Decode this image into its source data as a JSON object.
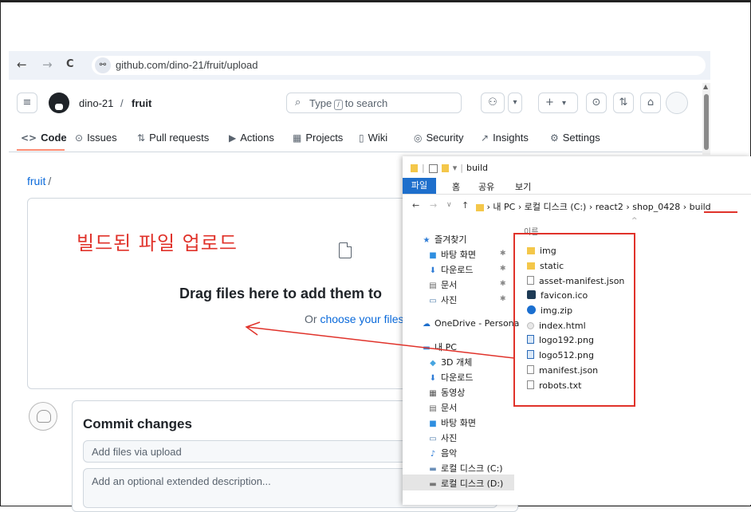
{
  "browser": {
    "back_icon": "←",
    "forward_icon": "→",
    "reload_icon": "C",
    "site_icon": "⚯",
    "url": "github.com/dino-21/fruit/upload"
  },
  "header": {
    "owner": "dino-21",
    "separator": "/",
    "repo": "fruit",
    "search_placeholder_pre": "Type",
    "search_key": "/",
    "search_placeholder_post": "to search",
    "menu_icon": "≡",
    "copilot_icon": "⚇",
    "dropdown_icon": "▾",
    "plus_icon": "+",
    "issues_icon": "⊙",
    "pr_icon": "⇅",
    "inbox_icon": "⌂"
  },
  "tabs": [
    {
      "icon": "<>",
      "label": "Code"
    },
    {
      "icon": "⊙",
      "label": "Issues"
    },
    {
      "icon": "⇅",
      "label": "Pull requests"
    },
    {
      "icon": "▶",
      "label": "Actions"
    },
    {
      "icon": "▦",
      "label": "Projects"
    },
    {
      "icon": "▯",
      "label": "Wiki"
    },
    {
      "icon": "◎",
      "label": "Security"
    },
    {
      "icon": "↗",
      "label": "Insights"
    },
    {
      "icon": "⚙",
      "label": "Settings"
    }
  ],
  "breadcrumb": {
    "repo": "fruit",
    "sep": "/"
  },
  "upload": {
    "title": "Drag files here to add them to",
    "sub_pre": "Or",
    "sub_link": "choose your files"
  },
  "annotation": "빌드된 파일 업로드",
  "commit": {
    "title": "Commit changes",
    "summary_placeholder": "Add files via upload",
    "description_placeholder": "Add an optional extended description..."
  },
  "explorer": {
    "title": "build",
    "ribbon": [
      "파일",
      "홈",
      "공유",
      "보기"
    ],
    "path": [
      "내 PC",
      "로컬 디스크 (C:)",
      "react2",
      "shop_0428",
      "build"
    ],
    "path_sep": "›",
    "column_header": "이름",
    "nav": [
      {
        "icon": "★",
        "label": "즐겨찾기",
        "pinned": false,
        "color": "#2f7cd6"
      },
      {
        "icon": "■",
        "label": "바탕 화면",
        "pinned": true,
        "color": "#2f8fe0"
      },
      {
        "icon": "⬇",
        "label": "다운로드",
        "pinned": true,
        "color": "#2f7cd6"
      },
      {
        "icon": "▤",
        "label": "문서",
        "pinned": true,
        "color": "#666666"
      },
      {
        "icon": "▭",
        "label": "사진",
        "pinned": true,
        "color": "#4a79a8"
      },
      {
        "icon": "☁",
        "label": "OneDrive - Persona",
        "pinned": false,
        "color": "#1e6fcc"
      },
      {
        "icon": "▬",
        "label": "내 PC",
        "pinned": false,
        "color": "#3b8ad8"
      },
      {
        "icon": "◆",
        "label": "3D 개체",
        "pinned": false,
        "color": "#46a4e0"
      },
      {
        "icon": "⬇",
        "label": "다운로드",
        "pinned": false,
        "color": "#2f7cd6"
      },
      {
        "icon": "▦",
        "label": "동영상",
        "pinned": false,
        "color": "#555555"
      },
      {
        "icon": "▤",
        "label": "문서",
        "pinned": false,
        "color": "#666666"
      },
      {
        "icon": "■",
        "label": "바탕 화면",
        "pinned": false,
        "color": "#2f8fe0"
      },
      {
        "icon": "▭",
        "label": "사진",
        "pinned": false,
        "color": "#4a79a8"
      },
      {
        "icon": "♪",
        "label": "음악",
        "pinned": false,
        "color": "#2f7cd6"
      },
      {
        "icon": "▬",
        "label": "로컬 디스크 (C:)",
        "pinned": false,
        "color": "#6a8fb8"
      },
      {
        "icon": "▬",
        "label": "로컬 디스크 (D:)",
        "pinned": false,
        "color": "#777777"
      }
    ],
    "files": [
      {
        "name": "img",
        "type": "folder"
      },
      {
        "name": "static",
        "type": "folder"
      },
      {
        "name": "asset-manifest.json",
        "type": "doc"
      },
      {
        "name": "favicon.ico",
        "type": "ico"
      },
      {
        "name": "img.zip",
        "type": "zip"
      },
      {
        "name": "index.html",
        "type": "html"
      },
      {
        "name": "logo192.png",
        "type": "png"
      },
      {
        "name": "logo512.png",
        "type": "png"
      },
      {
        "name": "manifest.json",
        "type": "doc"
      },
      {
        "name": "robots.txt",
        "type": "doc"
      }
    ]
  },
  "colors": {
    "annotation": "#e0322a",
    "link": "#0969da",
    "explorer_accent": "#1e6fcc"
  }
}
